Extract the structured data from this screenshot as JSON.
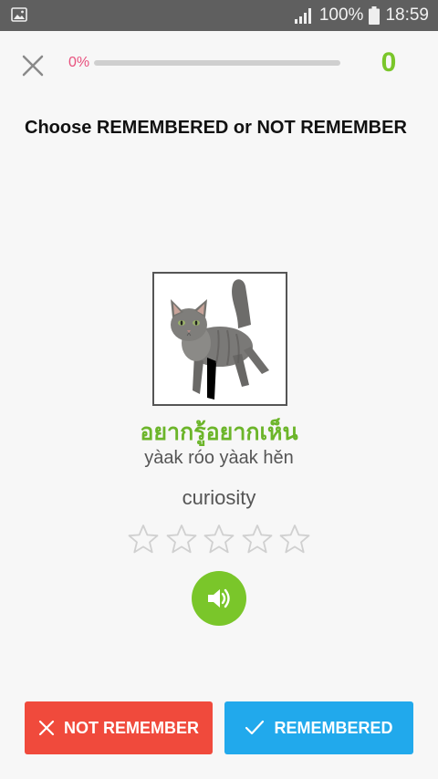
{
  "status_bar": {
    "battery_percent": "100%",
    "time": "18:59"
  },
  "top_bar": {
    "progress_text": "0%",
    "progress_value": 0,
    "score": "0"
  },
  "instruction": "Choose REMEMBERED or NOT REMEMBER",
  "card": {
    "image_subject": "cat",
    "thai": "อยากรู้อยากเห็น",
    "romanization": "yàak róo yàak hěn",
    "meaning": "curiosity",
    "rating": 0,
    "rating_max": 5
  },
  "buttons": {
    "not_remember": "NOT REMEMBER",
    "remembered": "REMEMBERED"
  },
  "colors": {
    "accent_green": "#7ac62a",
    "progress_pink": "#e8507d",
    "not_remember_red": "#f04a3c",
    "remembered_blue": "#21a9ec",
    "status_bar": "#5f5f5f"
  },
  "icons": {
    "status_left": "image-icon",
    "signal": "signal-icon",
    "battery": "battery-icon",
    "close": "close-icon",
    "star": "star-outline-icon",
    "sound": "speaker-icon",
    "not_remember": "x-icon",
    "remembered": "check-icon"
  }
}
